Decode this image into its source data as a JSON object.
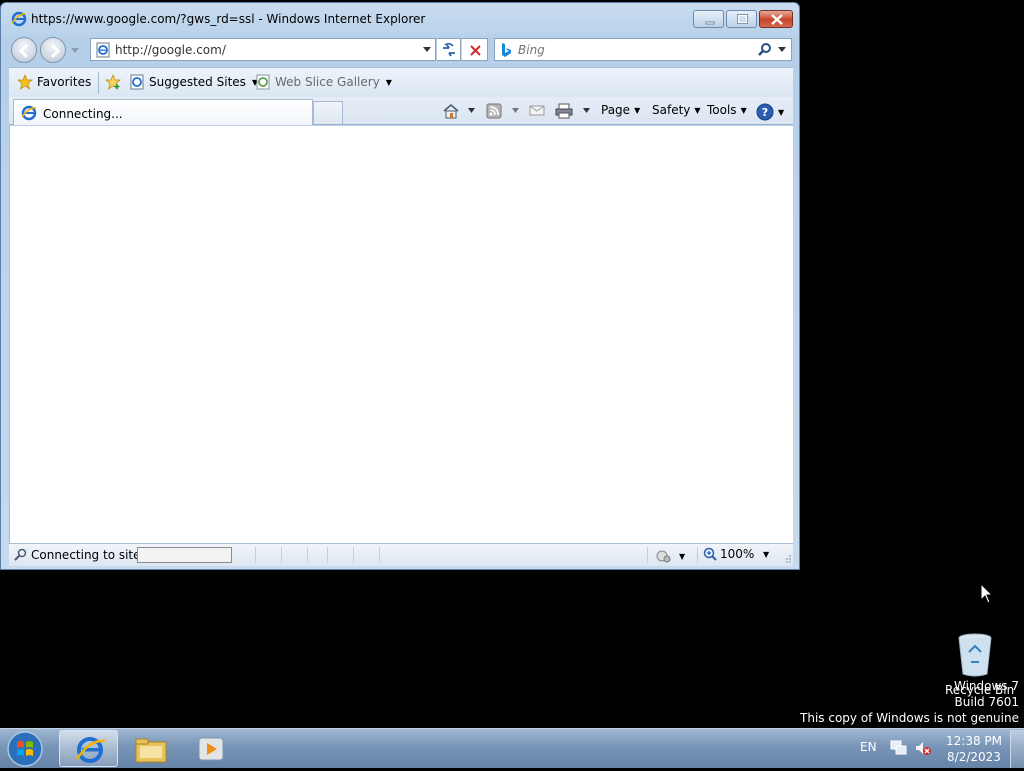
{
  "window": {
    "title": "https://www.google.com/?gws_rd=ssl - Windows Internet Explorer"
  },
  "address_bar": {
    "value": "http://google.com/"
  },
  "search_bar": {
    "placeholder": "Bing"
  },
  "favorites_bar": {
    "favorites_label": "Favorites",
    "suggested_sites_label": "Suggested Sites",
    "web_slice_gallery_label": "Web Slice Gallery"
  },
  "tab": {
    "label": "Connecting..."
  },
  "command_bar": {
    "page_label": "Page",
    "safety_label": "Safety",
    "tools_label": "Tools"
  },
  "status_bar": {
    "status_text": "Connecting to site 2",
    "progress": 0.0,
    "zoom": "100%"
  },
  "desktop": {
    "recycle_bin_label": "Recycle Bin",
    "watermark_line1": "Windows 7",
    "watermark_line2": "Build 7601",
    "watermark_line3": "This copy of Windows is not genuine"
  },
  "taskbar": {
    "language": "EN",
    "time": "12:38 PM",
    "date": "8/2/2023"
  },
  "colors": {
    "close_button": "#c8452c",
    "taskbar": "#7894b6",
    "desktop": "#000000"
  }
}
